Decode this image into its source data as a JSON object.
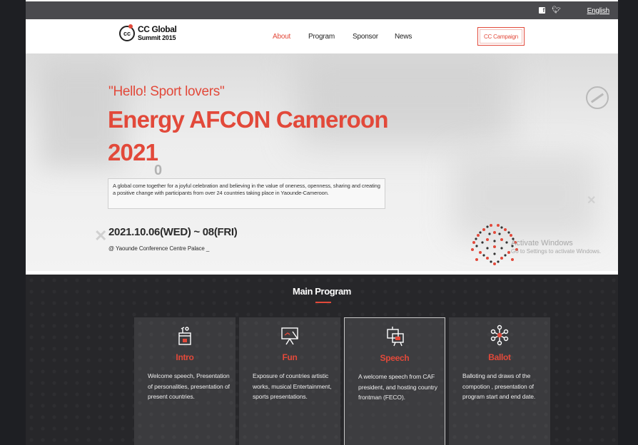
{
  "topbar": {
    "social_icons": [
      "facebook-icon",
      "twitter-icon"
    ],
    "language": "English"
  },
  "navbar": {
    "logo": {
      "line1": "CC Global",
      "line2": "Summit 2015",
      "mark": "cc"
    },
    "menu": [
      "About",
      "Program",
      "Sponsor",
      "News"
    ],
    "active_menu": "About",
    "campaign_button": "CC Campaign"
  },
  "hero": {
    "greeting": "\"Hello! Sport lovers\"",
    "title_line1": "Energy AFCON Cameroon",
    "title_line2": "2021",
    "description": "A global come together for a joyful celebration and believing in the value of oneness, openness, sharing and creating a positive change with participants from over 24 countries taking place in Yaounde-Cameroon.",
    "date": "2021.10.06(WED) ~ 08(FRI)",
    "venue": "@ Yaounde Conference Centre Palace _",
    "zero_mark": "0",
    "watermark_line1": "Activate Windows",
    "watermark_line2": "Go to Settings to activate Windows."
  },
  "main_program": {
    "title": "Main Program",
    "cards": [
      {
        "title": "Intro",
        "icon": "podium-icon",
        "body": "Welcome speech, Presentation of personalities, presentation of present countries."
      },
      {
        "title": "Fun",
        "icon": "presentation-board-icon",
        "body": "Exposure of countries artistic works, musical Entertainment, sports presentations."
      },
      {
        "title": "Speech",
        "icon": "slides-icon",
        "body": "A welcome speech from CAF president, and hosting country frontman (FECO)."
      },
      {
        "title": "Ballot",
        "icon": "network-icon",
        "body": "Balloting and draws of the compotion , presentation of program start and end date."
      }
    ],
    "active_card": "Speech"
  },
  "colors": {
    "accent": "#e2493a",
    "topbar": "#4a4a4e",
    "dark_section": "#27272a",
    "card": "#3b3b3e",
    "page_background": "#1e1f23"
  }
}
